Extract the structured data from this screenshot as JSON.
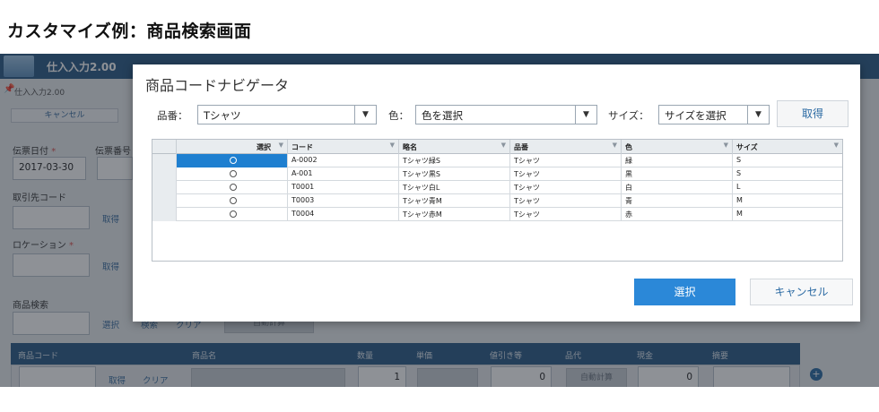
{
  "heading": "カスタマイズ例：商品検索画面",
  "app": {
    "title": "仕入入力2.00",
    "breadcrumb": "仕入入力2.00",
    "cancel_label": "キャンセル",
    "date_label": "伝票日付",
    "slip_label": "伝票番号",
    "date_value": "2017-03-30",
    "supplier_label": "取引先コード",
    "get_label": "取得",
    "location_label": "ロケーション",
    "product_search_label": "商品検索",
    "select_label": "選択",
    "search_label": "検索",
    "clear_label": "クリア",
    "auto_calc": "自動計算",
    "table_headers": [
      "商品コード",
      "商品名",
      "数量",
      "単価",
      "値引き等",
      "品代",
      "現金",
      "摘要"
    ],
    "row": {
      "get": "取得",
      "clear": "クリア",
      "qty": "1",
      "discount": "0",
      "auto": "自動計算",
      "cash": "0"
    }
  },
  "dialog": {
    "title": "商品コードナビゲータ",
    "filters": {
      "item_label": "品番：",
      "item_value": "Tシャツ",
      "color_label": "色：",
      "color_value": "色を選択",
      "size_label": "サイズ：",
      "size_value": "サイズを選択"
    },
    "get_button": "取得",
    "columns": [
      "選択",
      "コード",
      "略名",
      "品番",
      "色",
      "サイズ"
    ],
    "rows": [
      {
        "code": "A-0002",
        "name": "Tシャツ緑S",
        "item": "Tシャツ",
        "color": "緑",
        "size": "S"
      },
      {
        "code": "A-001",
        "name": "Tシャツ黒S",
        "item": "Tシャツ",
        "color": "黒",
        "size": "S"
      },
      {
        "code": "T0001",
        "name": "Tシャツ白L",
        "item": "Tシャツ",
        "color": "白",
        "size": "L"
      },
      {
        "code": "T0003",
        "name": "Tシャツ青M",
        "item": "Tシャツ",
        "color": "青",
        "size": "M"
      },
      {
        "code": "T0004",
        "name": "Tシャツ赤M",
        "item": "Tシャツ",
        "color": "赤",
        "size": "M"
      }
    ],
    "select_button": "選択",
    "cancel_button": "キャンセル"
  }
}
